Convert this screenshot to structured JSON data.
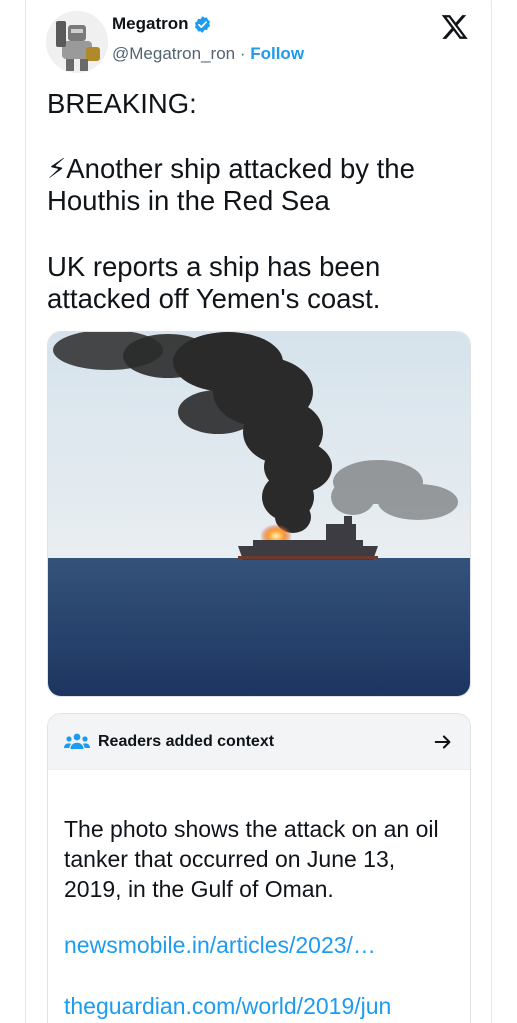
{
  "author": {
    "name": "Megatron",
    "handle": "@Megatron_ron",
    "separator": " · ",
    "follow_label": "Follow"
  },
  "tweet": {
    "breaking": "BREAKING:",
    "headline": "⚡Another ship attacked by the Houthis in the Red Sea",
    "body": "UK reports a ship has been attacked off Yemen's coast."
  },
  "media": {
    "description_icon": "photo"
  },
  "context": {
    "title": "Readers added context",
    "note": "The photo shows the attack on an oil tanker that occurred on June 13, 2019, in the Gulf of Oman.",
    "links": [
      "newsmobile.in/articles/2023/…",
      "theguardian.com/world/2019/jun"
    ]
  },
  "colors": {
    "accent": "#1d9bf0",
    "text": "#0f1419",
    "secondary": "#536471"
  },
  "icons": [
    "verified-icon",
    "x-logo-icon",
    "people-icon",
    "arrow-right-icon"
  ]
}
